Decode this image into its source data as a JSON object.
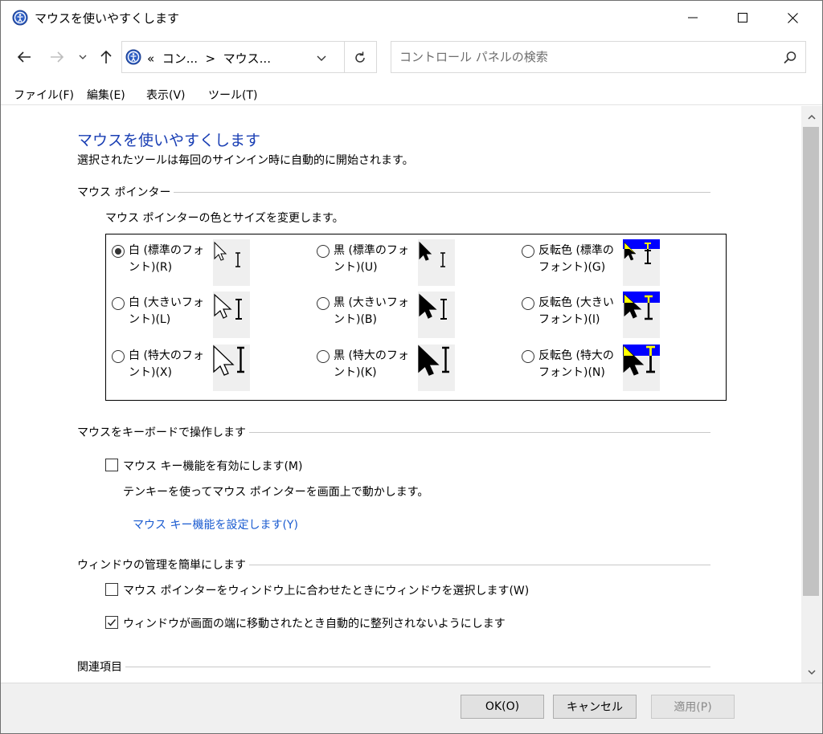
{
  "window": {
    "title": "マウスを使いやすくします",
    "icon": "ease-of-access-icon"
  },
  "address": {
    "path": "«  コン...  >  マウス...",
    "search_placeholder": "コントロール パネルの検索"
  },
  "menu": [
    "ファイル(F)",
    "編集(E)",
    "表示(V)",
    "ツール(T)"
  ],
  "page": {
    "heading": "マウスを使いやすくします",
    "description": "選択されたツールは毎回のサインイン時に自動的に開始されます。"
  },
  "pointer_section": {
    "title": "マウス ポインター",
    "subtitle": "マウス ポインターの色とサイズを変更します。",
    "options": [
      {
        "label": "白 (標準のフォント)(R)",
        "checked": true
      },
      {
        "label": "黒 (標準のフォント)(U)",
        "checked": false
      },
      {
        "label": "反転色 (標準のフォント)(G)",
        "checked": false
      },
      {
        "label": "白 (大きいフォント)(L)",
        "checked": false
      },
      {
        "label": "黒 (大きいフォント)(B)",
        "checked": false
      },
      {
        "label": "反転色 (大きいフォント)(I)",
        "checked": false
      },
      {
        "label": "白 (特大のフォント)(X)",
        "checked": false
      },
      {
        "label": "黒 (特大のフォント)(K)",
        "checked": false
      },
      {
        "label": "反転色 (特大のフォント)(N)",
        "checked": false
      }
    ]
  },
  "keyboard_section": {
    "title": "マウスをキーボードで操作します",
    "mouse_keys_label": "マウス キー機能を有効にします(M)",
    "mouse_keys_checked": false,
    "mouse_keys_desc": "テンキーを使ってマウス ポインターを画面上で動かします。",
    "setup_link": "マウス キー機能を設定します(Y)"
  },
  "window_section": {
    "title": "ウィンドウの管理を簡単にします",
    "hover_select_label": "マウス ポインターをウィンドウ上に合わせたときにウィンドウを選択します(W)",
    "hover_select_checked": false,
    "no_snap_label": "ウィンドウが画面の端に移動されたとき自動的に整列されないようにします",
    "no_snap_checked": true
  },
  "related": {
    "title": "関連項目"
  },
  "buttons": {
    "ok": "OK(O)",
    "cancel": "キャンセル",
    "apply": "適用(P)"
  },
  "colors": {
    "heading": "#1a3fb4",
    "link": "#1a5bd0",
    "inverted_bg": "#0000ff",
    "inverted_fg": "#ffff00"
  }
}
